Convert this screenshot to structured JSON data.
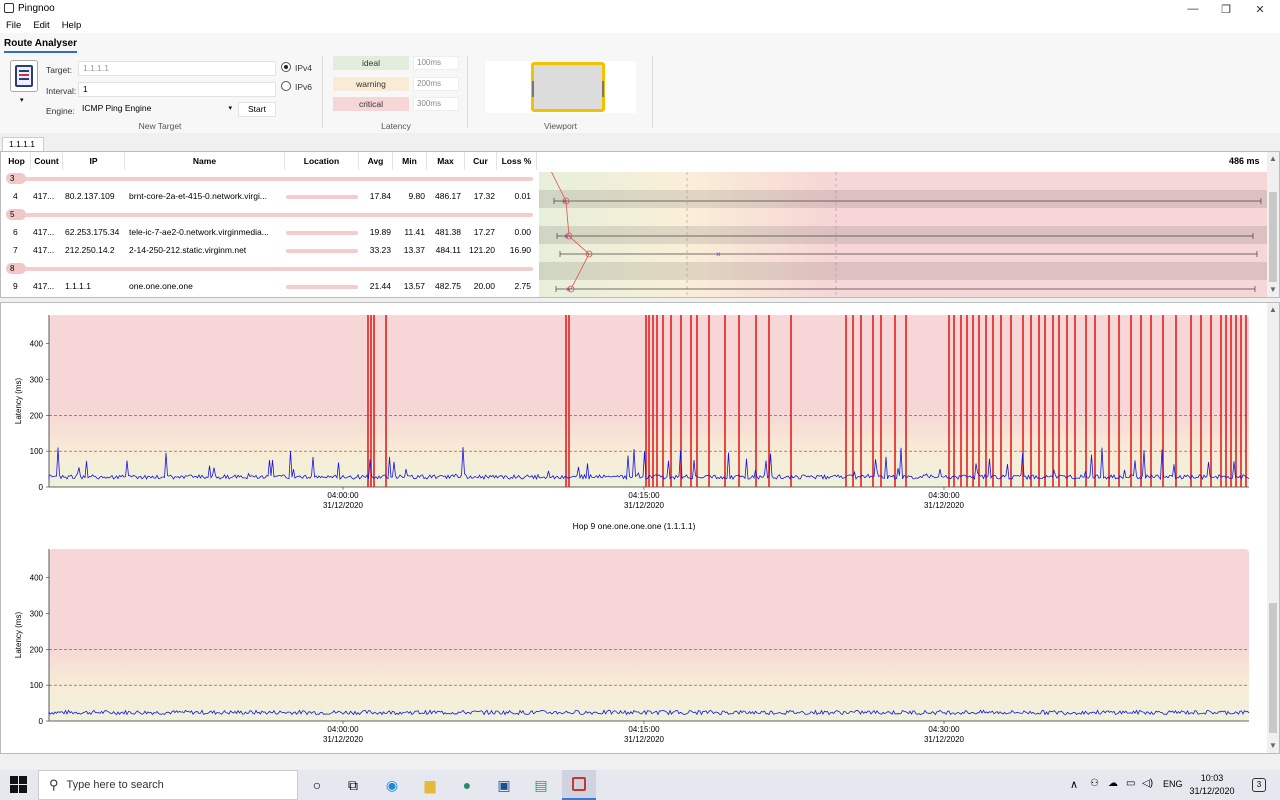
{
  "window": {
    "title": "Pingnoo",
    "min": "—",
    "max": "❐",
    "close": "✕"
  },
  "menu": [
    "File",
    "Edit",
    "Help"
  ],
  "ribbon": {
    "tab_title": "Route Analyser",
    "target_label": "Target:",
    "target_placeholder": "1.1.1.1",
    "interval_label": "Interval:",
    "interval_value": "1",
    "engine_label": "Engine:",
    "engine_value": "ICMP Ping Engine",
    "start_label": "Start",
    "ipv4_label": "IPv4",
    "ipv6_label": "IPv6",
    "new_target_label": "New Target",
    "latency_group_label": "Latency",
    "viewport_label": "Viewport",
    "latency": [
      {
        "name": "ideal",
        "value": "100ms",
        "color": "#e2eedb"
      },
      {
        "name": "warning",
        "value": "200ms",
        "color": "#f9ecd6"
      },
      {
        "name": "critical",
        "value": "300ms",
        "color": "#f6d6d6"
      }
    ]
  },
  "tab_label": "1.1.1.1",
  "table": {
    "headers": [
      "Hop",
      "Count",
      "IP",
      "Name",
      "Location",
      "Avg",
      "Min",
      "Max",
      "Cur",
      "Loss %"
    ],
    "max_label": "486 ms",
    "rows": [
      {
        "hop": "3",
        "empty": true
      },
      {
        "hop": "4",
        "count": "417...",
        "ip": "80.2.137.109",
        "name": "brnt-core-2a-et-415-0.network.virgi...",
        "avg": "17.84",
        "min": "9.80",
        "max": "486.17",
        "cur": "17.32",
        "loss": "0.01"
      },
      {
        "hop": "5",
        "empty": true
      },
      {
        "hop": "6",
        "count": "417...",
        "ip": "62.253.175.34",
        "name": "tele-ic-7-ae2-0.network.virginmedia...",
        "avg": "19.89",
        "min": "11.41",
        "max": "481.38",
        "cur": "17.27",
        "loss": "0.00"
      },
      {
        "hop": "7",
        "count": "417...",
        "ip": "212.250.14.2",
        "name": "2-14-250-212.static.virginm.net",
        "avg": "33.23",
        "min": "13.37",
        "max": "484.11",
        "cur": "121.20",
        "loss": "16.90"
      },
      {
        "hop": "8",
        "empty": true
      },
      {
        "hop": "9",
        "count": "417...",
        "ip": "1.1.1.1",
        "name": "one.one.one.one",
        "avg": "21.44",
        "min": "13.57",
        "max": "482.75",
        "cur": "20.00",
        "loss": "2.75"
      }
    ]
  },
  "charts": [
    {
      "title": "",
      "ylabel": "Latency (ms)",
      "yticks": [
        "0",
        "100",
        "200",
        "300",
        "400"
      ],
      "xticks": [
        {
          "time": "04:00:00",
          "date": "31/12/2020"
        },
        {
          "time": "04:15:00",
          "date": "31/12/2020"
        },
        {
          "time": "04:30:00",
          "date": "31/12/2020"
        }
      ]
    },
    {
      "title": "Hop 9 one.one.one.one (1.1.1.1)",
      "ylabel": "Latency (ms)",
      "yticks": [
        "0",
        "100",
        "200",
        "300",
        "400"
      ],
      "xticks": [
        {
          "time": "04:00:00",
          "date": "31/12/2020"
        },
        {
          "time": "04:15:00",
          "date": "31/12/2020"
        },
        {
          "time": "04:30:00",
          "date": "31/12/2020"
        }
      ]
    }
  ],
  "taskbar": {
    "search_placeholder": "Type here to search",
    "lang": "ENG",
    "time": "10:03",
    "date": "31/12/2020",
    "notif_count": "3"
  }
}
